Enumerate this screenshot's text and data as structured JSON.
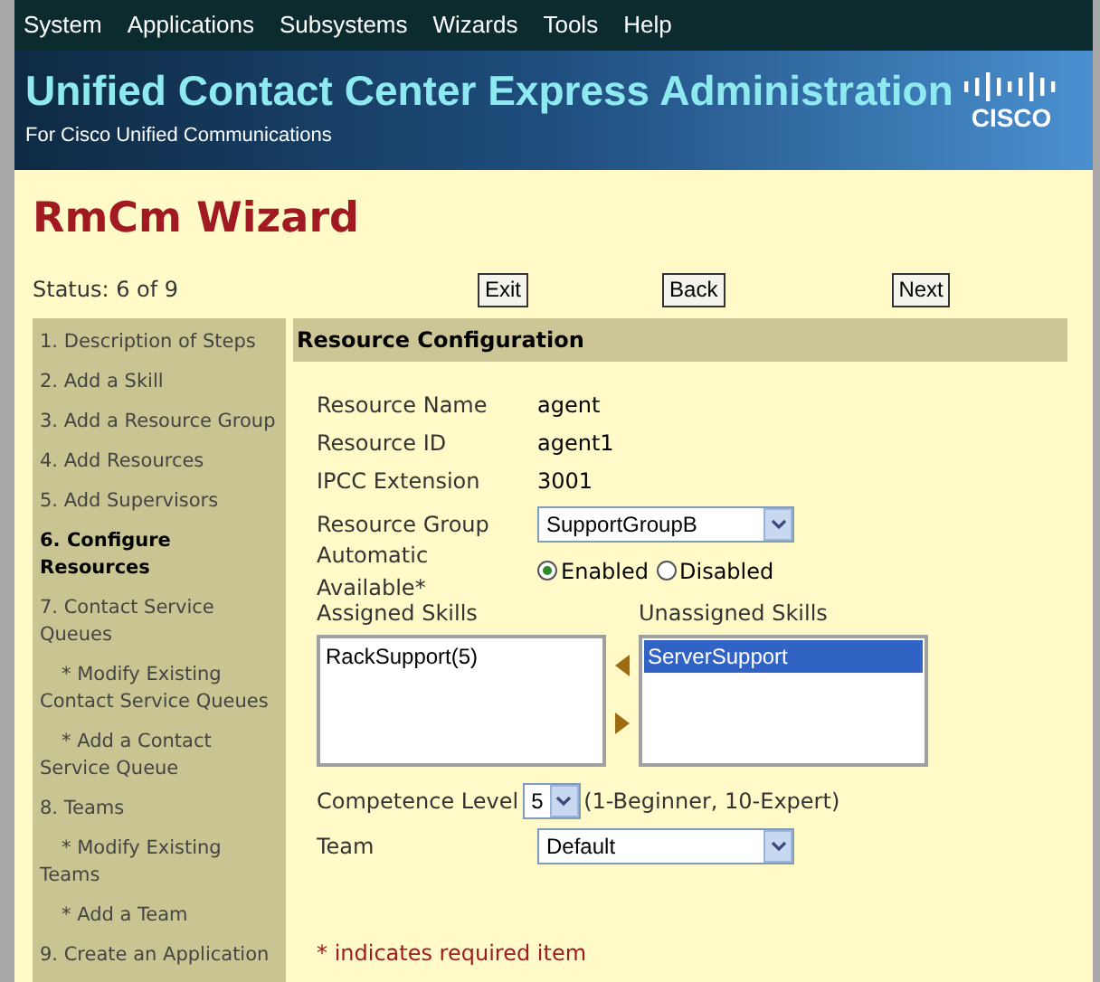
{
  "menu": [
    "System",
    "Applications",
    "Subsystems",
    "Wizards",
    "Tools",
    "Help"
  ],
  "banner": {
    "title": "Unified Contact Center Express Administration",
    "subtitle": "For Cisco Unified Communications",
    "logo": "CISCO"
  },
  "page_title": "RmCm Wizard",
  "status": "Status: 6 of 9",
  "buttons": [
    "Exit",
    "Back",
    "Next"
  ],
  "steps": [
    {
      "label": "1. Description of Steps",
      "kind": "step",
      "selected": false
    },
    {
      "label": "2. Add a Skill",
      "kind": "step",
      "selected": false
    },
    {
      "label": "3. Add a Resource Group",
      "kind": "step",
      "selected": false
    },
    {
      "label": "4. Add Resources",
      "kind": "step",
      "selected": false
    },
    {
      "label": "5. Add Supervisors",
      "kind": "step",
      "selected": false
    },
    {
      "label": "6. Configure Resources",
      "kind": "step",
      "selected": true
    },
    {
      "label": "7. Contact Service Queues",
      "kind": "step",
      "selected": false
    },
    {
      "label": "* Modify Existing Contact Service Queues",
      "kind": "substep",
      "selected": false
    },
    {
      "label": "* Add a Contact Service Queue",
      "kind": "substep",
      "selected": false
    },
    {
      "label": "8. Teams",
      "kind": "step",
      "selected": false
    },
    {
      "label": "* Modify Existing Teams",
      "kind": "substep",
      "selected": false
    },
    {
      "label": "* Add a Team",
      "kind": "substep",
      "selected": false
    },
    {
      "label": "9. Create an Application",
      "kind": "step",
      "selected": false
    }
  ],
  "section_title": "Resource Configuration",
  "fields": [
    {
      "label": "Resource Name",
      "value": "agent"
    },
    {
      "label": "Resource ID",
      "value": "agent1"
    },
    {
      "label": "IPCC Extension",
      "value": "3001"
    }
  ],
  "resource_group": {
    "label": "Resource Group",
    "value": "SupportGroupB"
  },
  "automatic_available": {
    "label": "Automatic Available*",
    "options": [
      {
        "label": "Enabled",
        "selected": true
      },
      {
        "label": "Disabled",
        "selected": false
      }
    ]
  },
  "assigned_skills": {
    "label": "Assigned Skills",
    "items": [
      {
        "label": "RackSupport(5)",
        "selected": false
      }
    ]
  },
  "unassigned_skills": {
    "label": "Unassigned Skills",
    "items": [
      {
        "label": "ServerSupport",
        "selected": true
      }
    ]
  },
  "competence": {
    "label": "Competence Level",
    "value": "5",
    "hint": "(1-Beginner, 10-Expert)"
  },
  "team": {
    "label": "Team",
    "value": "Default"
  },
  "required_note": "* indicates required item"
}
